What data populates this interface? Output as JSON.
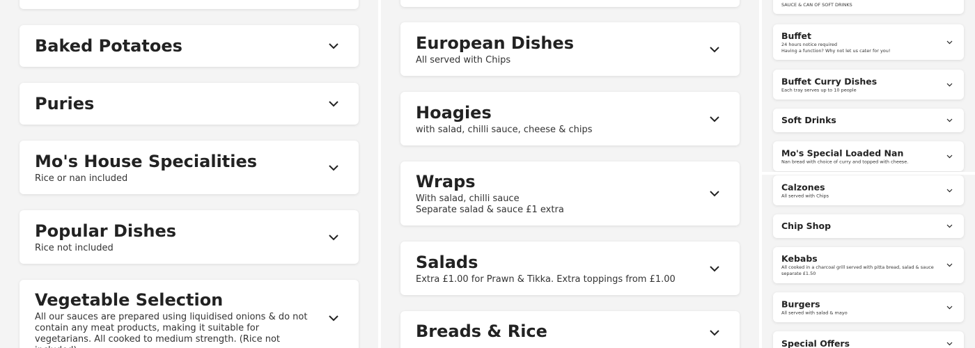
{
  "col1": {
    "cards": [
      {
        "title": "",
        "desc": ""
      },
      {
        "title": "Baked Potatoes",
        "desc": ""
      },
      {
        "title": "Puries",
        "desc": ""
      },
      {
        "title": "Mo's House Specialities",
        "desc": "Rice or nan included"
      },
      {
        "title": "Popular Dishes",
        "desc": "Rice not included"
      },
      {
        "title": "Vegetable Selection",
        "desc": "All our sauces are prepared using liquidised onions & do not contain any meat products, making it suitable for vegetarians. All cooked to medium strength. (Rice not included)"
      }
    ]
  },
  "col2": {
    "cards": [
      {
        "title": "",
        "desc": ""
      },
      {
        "title": "European Dishes",
        "desc": "All served with Chips"
      },
      {
        "title": "Hoagies",
        "desc": "with salad, chilli sauce, cheese & chips"
      },
      {
        "title": "Wraps",
        "desc": "With salad, chilli sauce",
        "desc2": "Separate salad & sauce £1 extra"
      },
      {
        "title": "Salads",
        "desc": "Extra £1.00 for Prawn & Tikka. Extra toppings from £1.00"
      },
      {
        "title": "Breads & Rice",
        "desc": ""
      }
    ]
  },
  "col3": {
    "top_cut": "SAUCE & CAN OF SOFT DRINKS",
    "cards": [
      {
        "title": "Buffet",
        "desc": "24 hours notice required",
        "desc2": "Having a function? Why not let us cater for you!"
      },
      {
        "title": "Buffet Curry Dishes",
        "desc": "Each tray serves up to 10 people"
      },
      {
        "title": "Soft Drinks",
        "desc": ""
      },
      {
        "title": "Mo's Special Loaded Nan",
        "desc": "Nan bread with choice of curry and topped with cheese."
      },
      {
        "title": "Calzones",
        "desc": "All served with Chips"
      },
      {
        "title": "Chip Shop",
        "desc": ""
      },
      {
        "title": "Kebabs",
        "desc": "All cooked in a charcoal grill served with pitta bread, salad & sauce separate £1.50"
      },
      {
        "title": "Burgers",
        "desc": "All served with salad & mayo"
      },
      {
        "title": "Special Offers",
        "desc": ""
      }
    ]
  },
  "icons": {
    "expand": "chevron-down-icon"
  },
  "colors": {
    "background": "#f4f4f4",
    "card": "#ffffff",
    "text": "#222222"
  }
}
